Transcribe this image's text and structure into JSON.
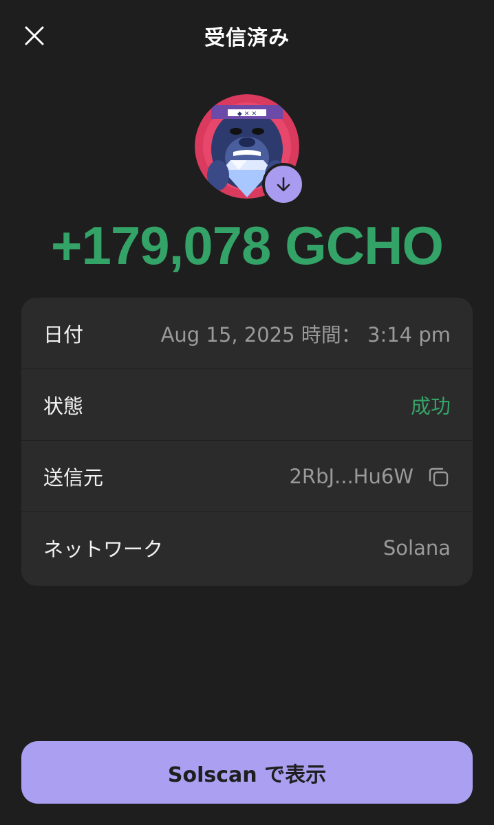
{
  "header": {
    "title": "受信済み"
  },
  "token": {
    "amount": "+179,078 GCHO",
    "badge_icon": "arrow-down-icon"
  },
  "details": [
    {
      "label": "日付",
      "value": "Aug 15, 2025 時間： 3:14 pm"
    },
    {
      "label": "状態",
      "value": "成功"
    },
    {
      "label": "送信元",
      "value": "2RbJ...Hu6W"
    },
    {
      "label": "ネットワーク",
      "value": "Solana"
    }
  ],
  "action": {
    "button_label": "Solscan で表示"
  },
  "colors": {
    "background": "#1e1e1e",
    "card": "#2b2b2b",
    "success": "#34a367",
    "accent": "#aa9ff0"
  }
}
